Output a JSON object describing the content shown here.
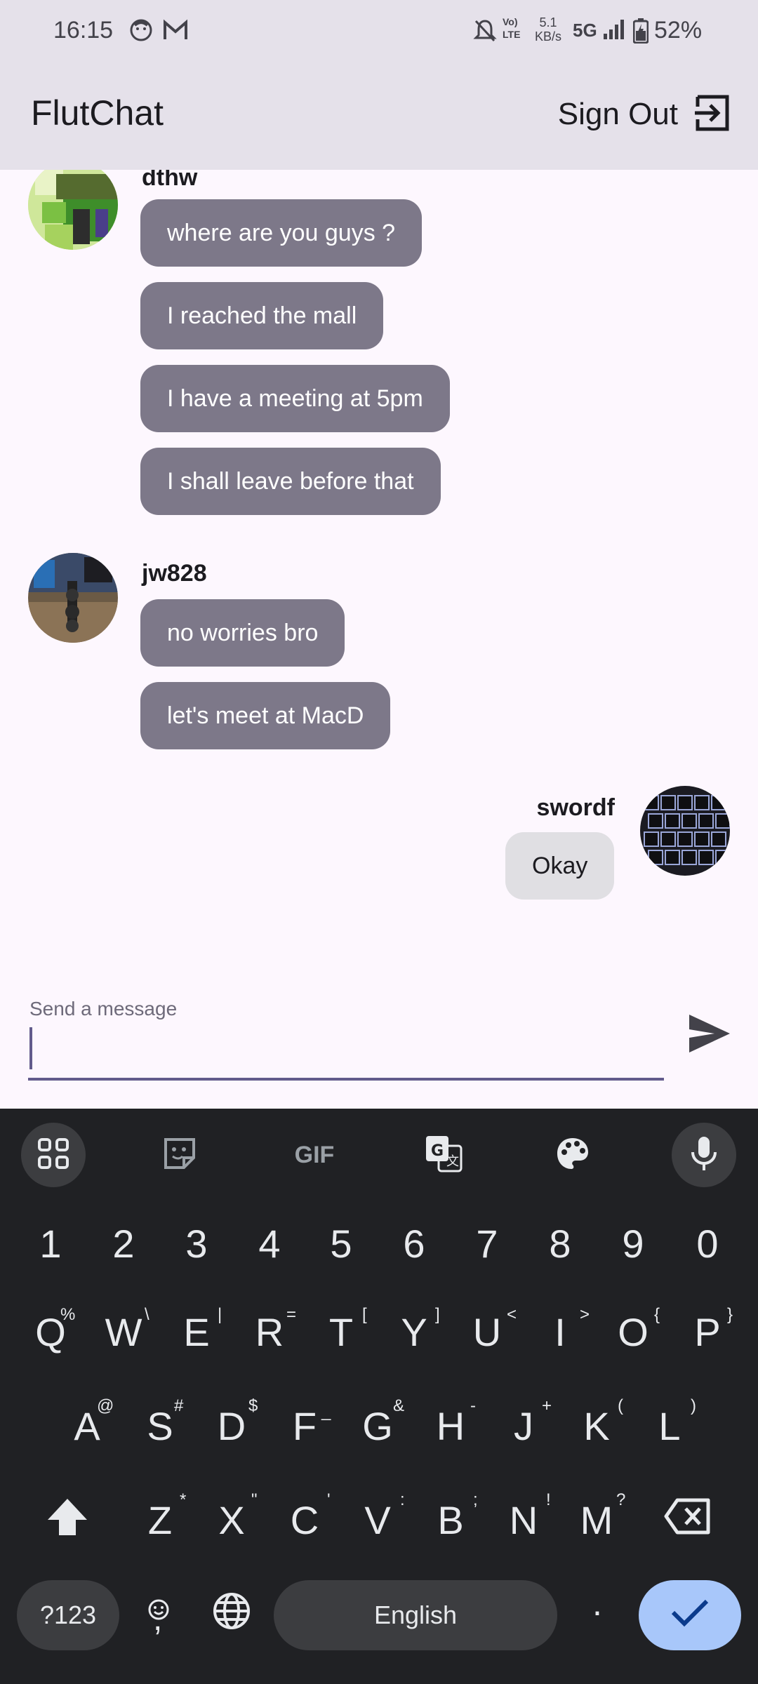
{
  "status_bar": {
    "time": "16:15",
    "speed_value": "5.1",
    "speed_unit": "KB/s",
    "network": "5G",
    "battery": "52%"
  },
  "app_bar": {
    "title": "FlutChat",
    "sign_out_label": "Sign Out"
  },
  "messages": [
    {
      "user": "dthw",
      "bubbles": [
        "where are you guys ?",
        "I reached the mall",
        "I have a meeting at 5pm",
        "I shall leave before that"
      ]
    },
    {
      "user": "jw828",
      "bubbles": [
        "no worries bro",
        "let's meet at MacD"
      ]
    },
    {
      "user": "swordf",
      "bubbles": [
        "Okay"
      ]
    }
  ],
  "composer": {
    "placeholder": "Send a message"
  },
  "keyboard": {
    "numbers": [
      "1",
      "2",
      "3",
      "4",
      "5",
      "6",
      "7",
      "8",
      "9",
      "0"
    ],
    "row1": [
      "Q",
      "W",
      "E",
      "R",
      "T",
      "Y",
      "U",
      "I",
      "O",
      "P"
    ],
    "row1_hints": [
      "%",
      "\\",
      "|",
      "=",
      "[",
      "]",
      "<",
      ">",
      "{",
      "}"
    ],
    "row2": [
      "A",
      "S",
      "D",
      "F",
      "G",
      "H",
      "J",
      "K",
      "L"
    ],
    "row2_hints": [
      "@",
      "#",
      "$",
      "_",
      "&",
      "-",
      "+",
      "(",
      ")"
    ],
    "row3": [
      "Z",
      "X",
      "C",
      "V",
      "B",
      "N",
      "M"
    ],
    "row3_hints": [
      "*",
      "\"",
      "'",
      ":",
      ";",
      "!",
      "?"
    ],
    "symbols_key": "?123",
    "emoji_comma": ",",
    "space_label": "English",
    "period": ".",
    "gif_label": "GIF"
  },
  "colors": {
    "accent": "#625b8c",
    "bubble_other": "#7d7889",
    "bubble_me": "#e0dfe3",
    "enter_key": "#a8c7fa"
  }
}
